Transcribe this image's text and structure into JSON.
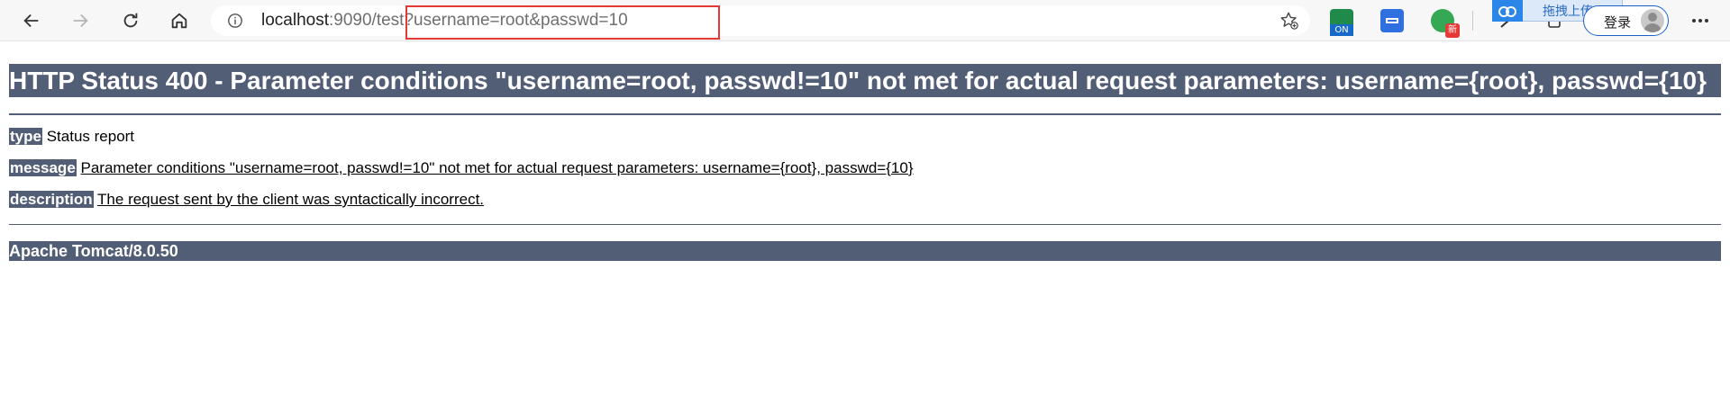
{
  "browser": {
    "url_host": "localhost",
    "url_rest": ":9090/test?username=root&passwd=10",
    "extensions": {
      "on_badge": "ON",
      "new_badge": "新"
    },
    "cloud_upload_label": "拖拽上传",
    "login_label": "登录",
    "icons": [
      "back-arrow-icon",
      "forward-arrow-icon",
      "reload-icon",
      "home-icon",
      "info-icon",
      "favorite-star-icon",
      "more-icon"
    ]
  },
  "page": {
    "title": "HTTP Status 400 - Parameter conditions \"username=root, passwd!=10\" not met for actual request parameters: username={root}, passwd={10}",
    "type_label": "type",
    "type_value": "Status report",
    "message_label": "message",
    "message_value": "Parameter conditions \"username=root, passwd!=10\" not met for actual request parameters: username={root}, passwd={10}",
    "description_label": "description",
    "description_value": "The request sent by the client was syntactically incorrect.",
    "footer": "Apache Tomcat/8.0.50"
  },
  "colors": {
    "tomcat_header": "#525d76",
    "highlight": "#e53935"
  }
}
